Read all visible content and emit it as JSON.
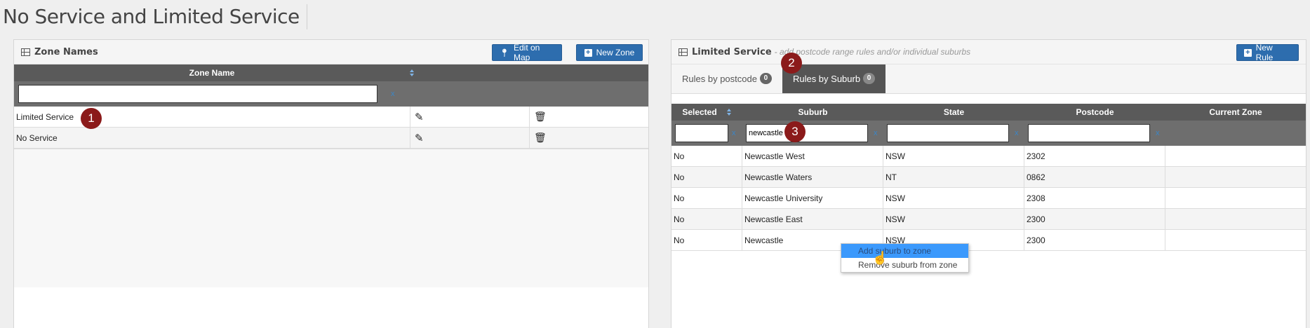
{
  "page": {
    "title": "No Service and Limited Service"
  },
  "zones_panel": {
    "title": "Zone Names",
    "edit_map_label": "Edit on Map",
    "new_zone_label": "New Zone",
    "column_header": "Zone Name",
    "filter_clear": "x",
    "rows": [
      {
        "name": "Limited Service"
      },
      {
        "name": "No Service"
      }
    ],
    "step_badge": "1"
  },
  "rules_panel": {
    "title": "Limited Service",
    "subtitle": "- add postcode range rules and/or individual suburbs",
    "new_rule_label": "New Rule",
    "tabs": [
      {
        "label": "Rules by postcode",
        "count": "0"
      },
      {
        "label": "Rules by Suburb",
        "count": "0"
      }
    ],
    "tab_step_badge": "2",
    "filter_step_badge": "3",
    "columns": [
      "Selected",
      "Suburb",
      "State",
      "Postcode",
      "Current Zone"
    ],
    "filters": {
      "selected": "",
      "suburb": "newcastle",
      "state": "",
      "postcode": ""
    },
    "filter_clear": "x",
    "rows": [
      {
        "selected": "No",
        "suburb": "Newcastle West",
        "state": "NSW",
        "postcode": "2302",
        "zone": ""
      },
      {
        "selected": "No",
        "suburb": "Newcastle Waters",
        "state": "NT",
        "postcode": "0862",
        "zone": ""
      },
      {
        "selected": "No",
        "suburb": "Newcastle University",
        "state": "NSW",
        "postcode": "2308",
        "zone": ""
      },
      {
        "selected": "No",
        "suburb": "Newcastle East",
        "state": "NSW",
        "postcode": "2300",
        "zone": ""
      },
      {
        "selected": "No",
        "suburb": "Newcastle",
        "state": "NSW",
        "postcode": "2300",
        "zone": ""
      }
    ]
  },
  "context_menu": {
    "items": [
      "Add suburb to zone",
      "Remove suburb from zone"
    ]
  },
  "colors": {
    "accent": "#2d6dae",
    "header": "#5a5a5a",
    "badge": "#8b1a1a",
    "menu_highlight": "#3b99fc"
  },
  "icons": {
    "table": "table-icon",
    "marker": "map-marker-icon",
    "plus": "plus-icon",
    "edit": "edit-icon",
    "trash": "trash-icon",
    "sort": "sort-icon",
    "cursor": "hand-cursor-icon"
  }
}
